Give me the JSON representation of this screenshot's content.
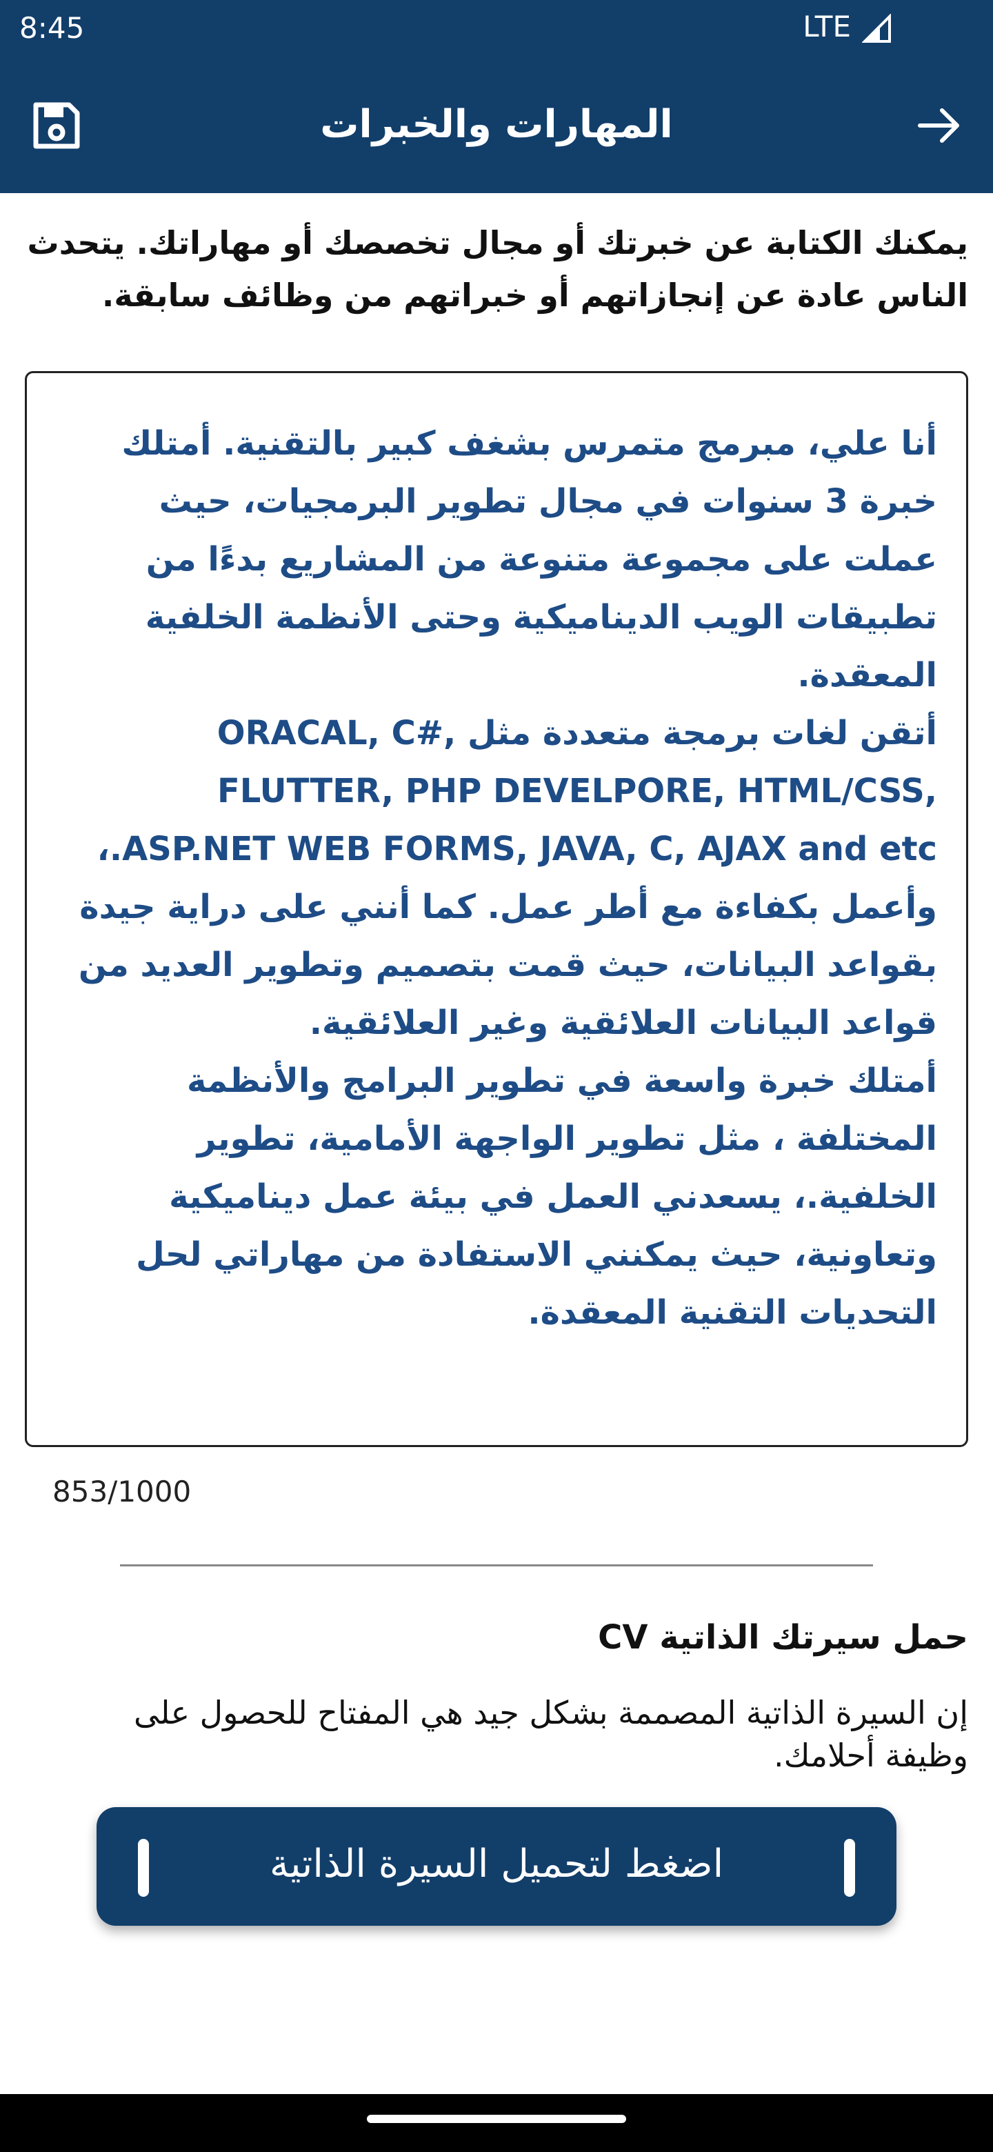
{
  "status_bar": {
    "time": "8:45",
    "network": "LTE"
  },
  "app_bar": {
    "title": "المهارات والخبرات",
    "save_icon": "save-icon",
    "back_icon": "arrow-right-icon"
  },
  "intro_text": "يمكنك الكتابة عن خبرتك أو مجال تخصصك أو مهاراتك. يتحدث الناس عادة عن إنجازاتهم أو خبراتهم من وظائف سابقة.",
  "experience_text": "أنا علي، مبرمج متمرس بشغف كبير بالتقنية. أمتلك خبرة 3 سنوات في مجال تطوير البرمجيات، حيث عملت على مجموعة متنوعة من المشاريع بدءًا من تطبيقات الويب الديناميكية وحتى الأنظمة الخلفية المعقدة.\nأتقن لغات برمجة متعددة مثل ORACAL, C#, FLUTTER, PHP DEVELPORE, HTML/CSS, ASP.NET WEB FORMS, JAVA, C, AJAX and etc.، وأعمل بكفاءة مع أطر عمل. كما أنني على دراية جيدة بقواعد البيانات، حيث قمت بتصميم وتطوير العديد من قواعد البيانات العلائقية وغير العلائقية.\nأمتلك خبرة واسعة في تطوير البرامج والأنظمة المختلفة ، مثل تطوير الواجهة الأمامية، تطوير الخلفية.، يسعدني العمل في بيئة عمل ديناميكية وتعاونية، حيث يمكنني الاستفادة من مهاراتي لحل التحديات التقنية المعقدة.",
  "char_counter": "853/1000",
  "cv_section": {
    "title": "حمل سيرتك الذاتية CV",
    "description": "إن السيرة الذاتية المصممة بشكل جيد هي المفتاح للحصول على وظيفة أحلامك.",
    "upload_button_label": "اضغط لتحميل السيرة الذاتية"
  },
  "colors": {
    "primary": "#123e6a",
    "text_blue": "#1e4c86"
  }
}
